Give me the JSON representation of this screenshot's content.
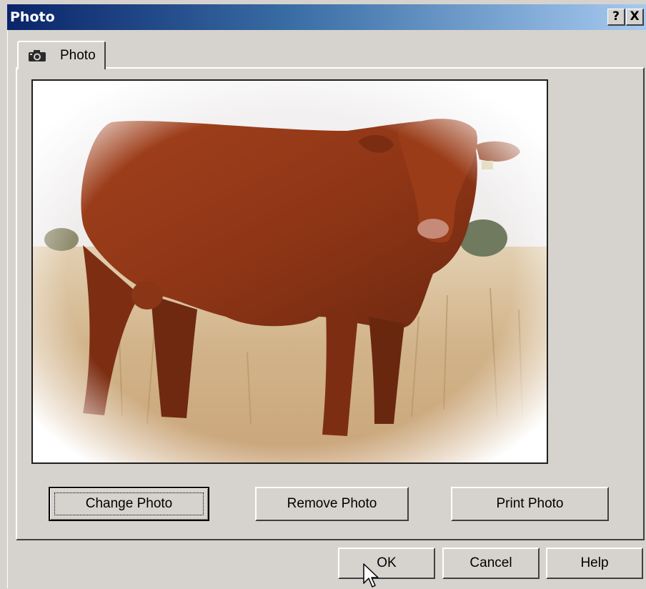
{
  "window": {
    "title": "Photo",
    "help_label": "?",
    "close_label": "X"
  },
  "tabs": [
    {
      "label": "Photo",
      "icon": "camera-icon"
    }
  ],
  "photo": {
    "description_icon": "photo-image"
  },
  "photo_actions": {
    "change_label": "Change Photo",
    "remove_label": "Remove Photo",
    "print_label": "Print Photo"
  },
  "dialog_buttons": {
    "ok_label": "OK",
    "cancel_label": "Cancel",
    "help_label": "Help"
  },
  "colors": {
    "titlebar_start": "#0a246a",
    "titlebar_end": "#a6caf0",
    "face": "#d6d3ce"
  }
}
